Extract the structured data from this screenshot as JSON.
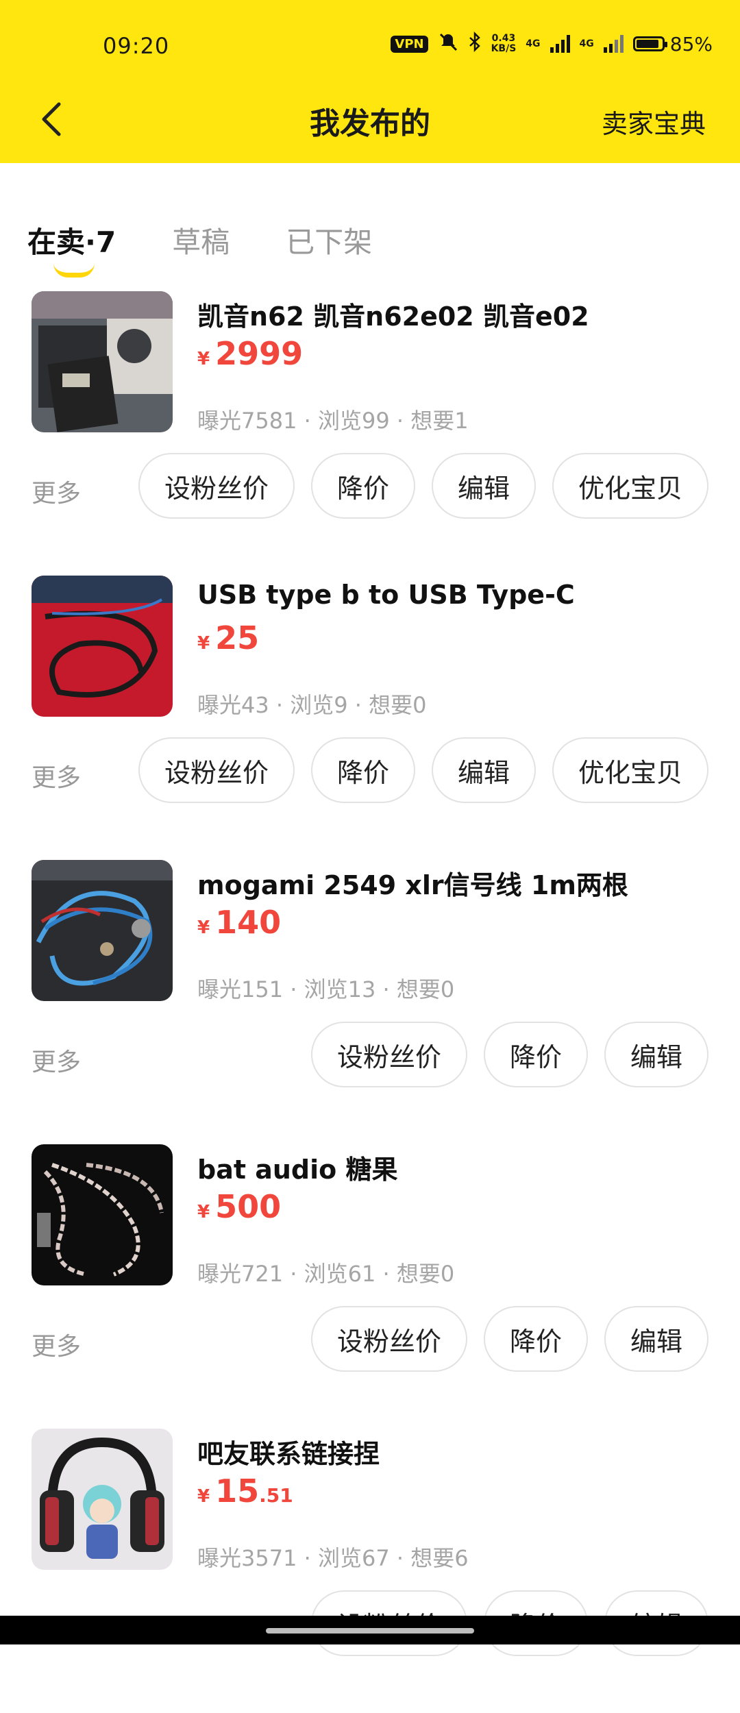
{
  "status_bar": {
    "time": "09:20",
    "vpn": "VPN",
    "speed_top": "0.43",
    "speed_bottom": "KB/S",
    "net1": "4G",
    "net2": "4G",
    "battery": "85%"
  },
  "header": {
    "title": "我发布的",
    "guide": "卖家宝典"
  },
  "tabs": [
    {
      "label": "在卖·7",
      "active": true
    },
    {
      "label": "草稿",
      "active": false
    },
    {
      "label": "已下架",
      "active": false
    }
  ],
  "currency": "¥",
  "more_label": "更多",
  "items": [
    {
      "title": "凯音n62 凯音n62e02 凯音e02",
      "price_int": "2999",
      "price_dec": "",
      "stats": "曝光7581 · 浏览99 · 想要1",
      "buttons": [
        "设粉丝价",
        "降价",
        "编辑",
        "优化宝贝"
      ],
      "thumb": "box-photo"
    },
    {
      "title": "USB type b to USB Type-C",
      "price_int": "25",
      "price_dec": "",
      "stats": "曝光43 · 浏览9 · 想要0",
      "buttons": [
        "设粉丝价",
        "降价",
        "编辑",
        "优化宝贝"
      ],
      "thumb": "red-cable-photo"
    },
    {
      "title": "mogami 2549 xlr信号线 1m两根",
      "price_int": "140",
      "price_dec": "",
      "stats": "曝光151 · 浏览13 · 想要0",
      "buttons": [
        "设粉丝价",
        "降价",
        "编辑"
      ],
      "thumb": "blue-cable-photo"
    },
    {
      "title": "bat audio 糖果",
      "price_int": "500",
      "price_dec": "",
      "stats": "曝光721 · 浏览61 · 想要0",
      "buttons": [
        "设粉丝价",
        "降价",
        "编辑"
      ],
      "thumb": "silver-cable-photo"
    },
    {
      "title": "吧友联系链接捏",
      "price_int": "15",
      "price_dec": ".51",
      "stats": "曝光3571 · 浏览67 · 想要6",
      "buttons": [
        "设粉丝价",
        "降价",
        "编辑"
      ],
      "thumb": "headphone-figure-photo"
    }
  ],
  "colors": {
    "brand_yellow": "#FFE60F",
    "price_red": "#F0463C"
  }
}
